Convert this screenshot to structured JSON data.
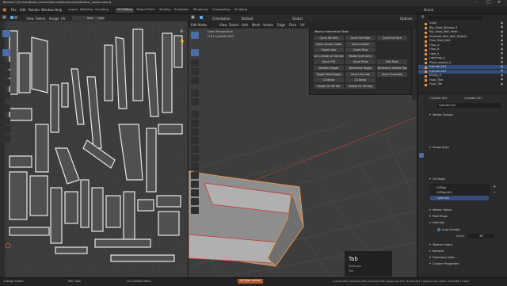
{
  "window": {
    "title": "Blender* [D:\\User\\Bolds_tutorial\\Source\\files\\Section\\Modular_Assets.blend]"
  },
  "menubar": {
    "items": [
      "File",
      "Edit",
      "Render",
      "Window",
      "Help"
    ],
    "workspaces": [
      "Layout",
      "Modeling",
      "Sculpting",
      "UV Editing",
      "Texture Paint",
      "Shading",
      "Animation",
      "Rendering",
      "Compositing",
      "Scripting"
    ],
    "active_workspace": "UV Editing",
    "scene": "Scene"
  },
  "uv_editor": {
    "menus": [
      "View",
      "Select",
      "Image",
      "UV"
    ],
    "image_name": "Open",
    "new_label": "New",
    "map_name": "Lightmap"
  },
  "viewport": {
    "mode": "Edit Mode",
    "menus": [
      "View",
      "Select",
      "Add",
      "Mesh",
      "Vertex",
      "Edge",
      "Face",
      "UV"
    ],
    "orientation": "Orientation:",
    "orientation_value": "Default",
    "pivot": "Global",
    "options": "Options",
    "overlay_line1": "User Perspective",
    "overlay_line2": "(13) Cylinder.003"
  },
  "pie_menu": {
    "title": "Maxivz Interactive Tools",
    "rows": [
      [
        "Quick Sel Vert",
        "Quick Sel Edge",
        "Quick Sel Face"
      ],
      [
        "Super Smart Create",
        "Smart Delete",
        ""
      ],
      [
        "Smart Loop",
        "Smart Ring",
        ""
      ],
      [
        "Set Cylinder at Obj Selet",
        "Radial Symmetry",
        ""
      ],
      [
        "Quick FFD",
        "Quick Pivot",
        "Edit Pivot"
      ],
      [
        "Modifier Toggle",
        "Wireframe Toggle",
        "Wireframe Shaded Tog"
      ],
      [
        "Target Weld Toggle",
        "Smart Extrude",
        "Smart Translate"
      ],
      [
        "CS Bevel",
        "CS Bevel",
        ""
      ],
      [
        "Rotate UV 90 Pos",
        "Rotate UV 90 Neg",
        ""
      ]
    ]
  },
  "tab_tip": {
    "key": "Tab",
    "line1": "NumLock",
    "line2": "Tab"
  },
  "outliner": {
    "items": [
      {
        "label": "Cube",
        "selected": false
      },
      {
        "label": "Big_Glass_Window_3",
        "selected": false
      },
      {
        "label": "Big_Glass_Wall_Mesh",
        "selected": false
      },
      {
        "label": "Enclosed_Roof_Wall_Module",
        "selected": false
      },
      {
        "label": "Floor_Roof_Wall",
        "selected": false
      },
      {
        "label": "Floor_A",
        "selected": false
      },
      {
        "label": "Floor_B",
        "selected": false
      },
      {
        "label": "Light_A",
        "selected": false
      },
      {
        "label": "Lightmap_A",
        "selected": false
      },
      {
        "label": "Plank_module_A",
        "selected": false
      },
      {
        "label": "Cylinder.003",
        "selected": true
      },
      {
        "label": "Cylinder.003",
        "selected": true
      },
      {
        "label": "Empty_A",
        "selected": false
      },
      {
        "label": "Floor_Trim",
        "selected": false
      },
      {
        "label": "Floor_Tile",
        "selected": false
      }
    ]
  },
  "properties": {
    "object_name": "Cylinder.003",
    "mesh_name": "Cylinder.011",
    "data_field": "Cylinder.011",
    "sections": [
      "Vertex Groups",
      "Shape Keys",
      "UV Maps",
      "Vertex Colors",
      "Face Maps",
      "Normals",
      "Texture Space",
      "Remesh",
      "Geometry Data",
      "Custom Properties"
    ],
    "uv_maps": [
      "UVMap",
      "UVMap.001",
      "Lightmap"
    ],
    "auto_smooth_label": "Auto Smooth",
    "angle_label": "Angle",
    "angle_value": "30°"
  },
  "statusbar": {
    "items": [
      "Change Frame",
      "Pan View",
      "UV Context Menu"
    ],
    "notice": "UV Sync Active",
    "stats": "Cylinder.003 | Verts:0/1,036 | Faces:0/1,004 | Edges:0/1,672 | Tris:0/4,072 | Objects:1/26 | Mem: 243.9 MiB | 2.90.0"
  },
  "colors": {
    "uv_background": "#3a3a3a",
    "viewport_background": "#3d3d3d",
    "selection_blue": "#334d7a",
    "active_tab": "#4a6ea8",
    "pie_button": "#3e3e3e",
    "edit_orange": "#e8934a"
  },
  "icons": [
    "cursor-icon",
    "select-box-icon",
    "move-icon",
    "rotate-icon",
    "scale-icon",
    "annotate-icon",
    "measure-icon",
    "hand-icon",
    "zoom-icon",
    "camera-icon",
    "grid-icon",
    "wrench-icon",
    "mesh-icon",
    "material-icon",
    "search-icon",
    "filter-icon",
    "eye-icon"
  ]
}
